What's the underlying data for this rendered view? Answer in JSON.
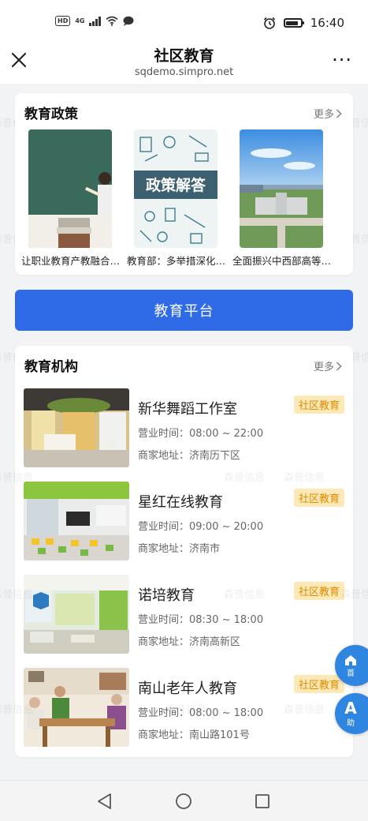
{
  "status_bar": {
    "hd": "HD",
    "network": "4G",
    "time": "16:40"
  },
  "header": {
    "title": "社区教育",
    "subtitle": "sqdemo.simpro.net",
    "more": "···"
  },
  "policy": {
    "title": "教育政策",
    "more_label": "更多",
    "items": [
      {
        "caption": "让职业教育产教融合……"
      },
      {
        "caption": "教育部：多举措深化……"
      },
      {
        "caption": "全面振兴中西部高等……"
      }
    ],
    "image_2_text": "政策解答"
  },
  "platform_button": "教育平台",
  "institutions": {
    "title": "教育机构",
    "more_label": "更多",
    "items": [
      {
        "name": "新华舞蹈工作室",
        "tag": "社区教育",
        "hours": "营业时间：08:00 ~ 22:00",
        "address": "商家地址：济南历下区"
      },
      {
        "name": "星红在线教育",
        "tag": "社区教育",
        "hours": "营业时间：09:00 ~ 20:00",
        "address": "商家地址：济南市"
      },
      {
        "name": "诺培教育",
        "tag": "社区教育",
        "hours": "营业时间：08:30 ~ 18:00",
        "address": "商家地址：济南高新区"
      },
      {
        "name": "南山老年人教育",
        "tag": "社区教育",
        "hours": "营业时间：08:00 ~ 18:00",
        "address": "商家地址：南山路101号"
      }
    ]
  },
  "float_buttons": {
    "home_label": "首",
    "assist_icon": "A",
    "assist_label": "助"
  },
  "watermark": "森普信息",
  "colors": {
    "accent": "#2f6be6",
    "tag_bg": "#fde9b8",
    "tag_text": "#e08b00",
    "float": "#2f86e0"
  }
}
